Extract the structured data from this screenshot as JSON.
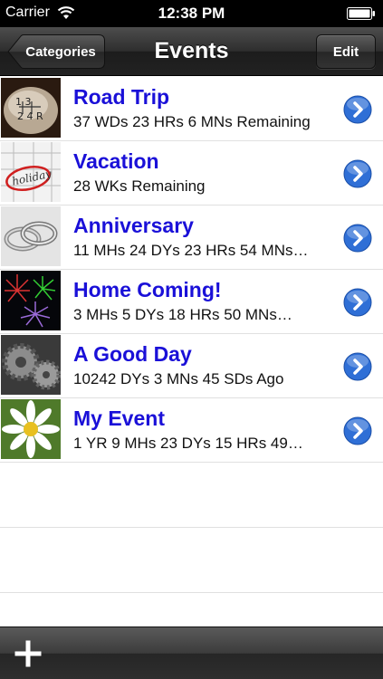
{
  "status_bar": {
    "carrier": "Carrier",
    "time": "12:38 PM"
  },
  "nav_bar": {
    "title": "Events",
    "back_label": "Categories",
    "edit_label": "Edit"
  },
  "events": [
    {
      "title": "Road Trip",
      "subtitle": "37 WDs 23 HRs 6 MNs Remaining",
      "thumbnail": "gear-shift-knob"
    },
    {
      "title": "Vacation",
      "subtitle": "28 WKs Remaining",
      "thumbnail": "calendar-holiday"
    },
    {
      "title": "Anniversary",
      "subtitle": "11 MHs 24 DYs 23 HRs 54 MNs…",
      "thumbnail": "wedding-rings"
    },
    {
      "title": "Home Coming!",
      "subtitle": "3 MHs 5 DYs 18 HRs 50 MNs…",
      "thumbnail": "fireworks"
    },
    {
      "title": "A Good Day",
      "subtitle": "10242 DYs 3 MNs 45 SDs Ago",
      "thumbnail": "gears"
    },
    {
      "title": "My Event",
      "subtitle": "1 YR 9 MHs 23 DYs 15 HRs 49…",
      "thumbnail": "daisy-flower"
    }
  ],
  "colors": {
    "title_blue": "#1a10d8",
    "disclosure_blue": "#2f6fd6"
  }
}
